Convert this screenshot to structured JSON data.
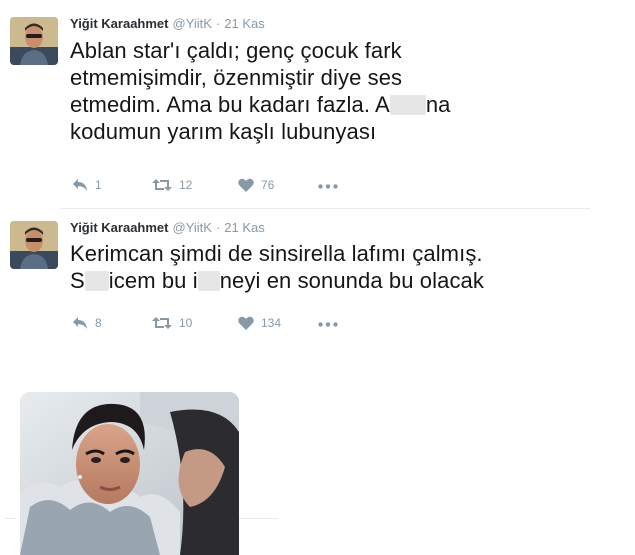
{
  "tweets": [
    {
      "author_name": "Yiğit Karaahmet",
      "handle": "@YiitK",
      "dot": "·",
      "date": "21 Kas",
      "text_lines": [
        [
          "Ablan star'ı çaldı; genç çocuk fark"
        ],
        [
          "etmemişimdir, özenmiştir diye ses"
        ],
        [
          "etmedim. Ama bu kadarı fazla. A",
          "",
          "na"
        ],
        [
          "kodumun yarım kaşlı lubunyası"
        ]
      ],
      "reply_count": "1",
      "retweet_count": "12",
      "like_count": "76"
    },
    {
      "author_name": "Yiğit Karaahmet",
      "handle": "@YiitK",
      "dot": "·",
      "date": "21 Kas",
      "text_lines": [
        [
          "Kerimcan şimdi de sinsirella lafımı çalmış."
        ],
        [
          "S",
          "",
          "icem bu i",
          "",
          "neyi en sonunda bu olacak"
        ]
      ],
      "reply_count": "8",
      "retweet_count": "10",
      "like_count": "134"
    }
  ],
  "icons": {
    "reply": "reply-icon",
    "retweet": "retweet-icon",
    "like": "heart-icon",
    "more": "more-icon"
  },
  "colors": {
    "icon_gray": "#8899a6",
    "text": "#14171a",
    "divider": "#e6ecf0"
  }
}
